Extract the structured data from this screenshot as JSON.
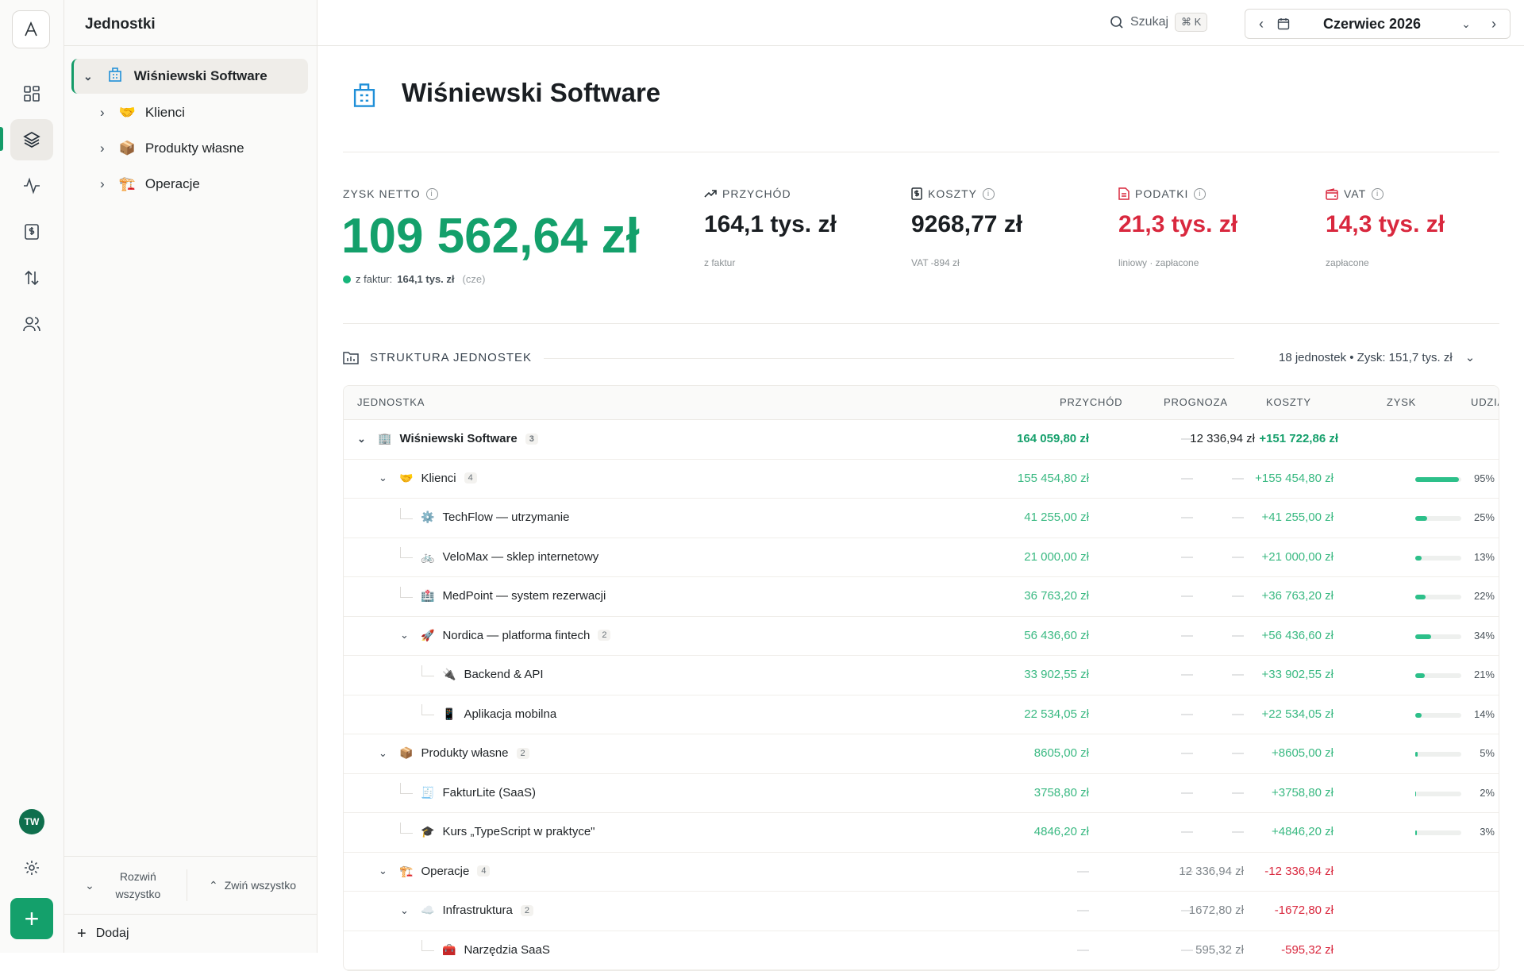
{
  "topbar": {
    "title": "Jednostki",
    "search_label": "Szukaj",
    "search_shortcut": "⌘ K",
    "month": "Czerwiec 2026"
  },
  "sidebar_user": "TW",
  "tree": {
    "root": "Wiśniewski Software",
    "items": [
      "Klienci",
      "Produkty własne",
      "Operacje"
    ],
    "expand_all": "Rozwiń wszystko",
    "collapse_all": "Zwiń wszystko",
    "add": "Dodaj"
  },
  "page": {
    "title": "Wiśniewski Software"
  },
  "kpis": {
    "net": {
      "label": "ZYSK NETTO",
      "value": "109 562,64 zł",
      "sub_prefix": "z faktur:",
      "sub_value": "164,1 tys. zł",
      "sub_suffix": "(cze)"
    },
    "revenue": {
      "label": "PRZYCHÓD",
      "value": "164,1 tys. zł",
      "sub": "z faktur"
    },
    "costs": {
      "label": "KOSZTY",
      "value": "9268,77 zł",
      "sub": "VAT -894 zł"
    },
    "taxes": {
      "label": "PODATKI",
      "value": "21,3 tys. zł",
      "sub": "liniowy · zapłacone"
    },
    "vat": {
      "label": "VAT",
      "value": "14,3 tys. zł",
      "sub": "zapłacone"
    }
  },
  "structure": {
    "label": "STRUKTURA JEDNOSTEK",
    "summary": "18 jednostek • Zysk: 151,7 tys. zł"
  },
  "table": {
    "headers": {
      "unit": "JEDNOSTKA",
      "revenue": "PRZYCHÓD",
      "forecast": "PROGNOZA",
      "costs": "KOSZTY",
      "profit": "ZYSK",
      "share": "UDZIAŁ"
    },
    "rows": [
      {
        "name": "Wiśniewski Software",
        "count": "3",
        "revenue": "164 059,80 zł",
        "forecast": "—",
        "costs": "12 336,94 zł",
        "profit": "+151 722,86 zł",
        "share": null,
        "share_label": "",
        "icon": "building-icon",
        "level": 0
      },
      {
        "name": "Klienci",
        "count": "4",
        "revenue": "155 454,80 zł",
        "forecast": "—",
        "costs": "—",
        "profit": "+155 454,80 zł",
        "share": 0.95,
        "share_label": "95%",
        "icon": "handshake-icon",
        "level": 1
      },
      {
        "name": "TechFlow — utrzymanie",
        "count": "",
        "revenue": "41 255,00 zł",
        "forecast": "—",
        "costs": "—",
        "profit": "+41 255,00 zł",
        "share": 0.25,
        "share_label": "25%",
        "icon": "gear-icon",
        "level": 2
      },
      {
        "name": "VeloMax — sklep internetowy",
        "count": "",
        "revenue": "21 000,00 zł",
        "forecast": "—",
        "costs": "—",
        "profit": "+21 000,00 zł",
        "share": 0.13,
        "share_label": "13%",
        "icon": "bicycle-icon",
        "level": 2
      },
      {
        "name": "MedPoint — system rezerwacji",
        "count": "",
        "revenue": "36 763,20 zł",
        "forecast": "—",
        "costs": "—",
        "profit": "+36 763,20 zł",
        "share": 0.22,
        "share_label": "22%",
        "icon": "hospital-icon",
        "level": 2
      },
      {
        "name": "Nordica — platforma fintech",
        "count": "2",
        "revenue": "56 436,60 zł",
        "forecast": "—",
        "costs": "—",
        "profit": "+56 436,60 zł",
        "share": 0.34,
        "share_label": "34%",
        "icon": "rocket-icon",
        "level": 2
      },
      {
        "name": "Backend & API",
        "count": "",
        "revenue": "33 902,55 zł",
        "forecast": "—",
        "costs": "—",
        "profit": "+33 902,55 zł",
        "share": 0.21,
        "share_label": "21%",
        "icon": "plug-icon",
        "level": 3
      },
      {
        "name": "Aplikacja mobilna",
        "count": "",
        "revenue": "22 534,05 zł",
        "forecast": "—",
        "costs": "—",
        "profit": "+22 534,05 zł",
        "share": 0.14,
        "share_label": "14%",
        "icon": "phone-icon",
        "level": 3
      },
      {
        "name": "Produkty własne",
        "count": "2",
        "revenue": "8605,00 zł",
        "forecast": "—",
        "costs": "—",
        "profit": "+8605,00 zł",
        "share": 0.05,
        "share_label": "5%",
        "icon": "package-icon",
        "level": 1
      },
      {
        "name": "FakturLite (SaaS)",
        "count": "",
        "revenue": "3758,80 zł",
        "forecast": "—",
        "costs": "—",
        "profit": "+3758,80 zł",
        "share": 0.02,
        "share_label": "2%",
        "icon": "receipt-icon",
        "level": 2
      },
      {
        "name": "Kurs „TypeScript w praktyce\"",
        "count": "",
        "revenue": "4846,20 zł",
        "forecast": "—",
        "costs": "—",
        "profit": "+4846,20 zł",
        "share": 0.03,
        "share_label": "3%",
        "icon": "graduation-cap-icon",
        "level": 2
      },
      {
        "name": "Operacje",
        "count": "4",
        "revenue": "—",
        "forecast": "—",
        "costs": "12 336,94 zł",
        "profit": "-12 336,94 zł",
        "share": null,
        "share_label": "",
        "icon": "crane-icon",
        "level": 1
      },
      {
        "name": "Infrastruktura",
        "count": "2",
        "revenue": "—",
        "forecast": "—",
        "costs": "1672,80 zł",
        "profit": "-1672,80 zł",
        "share": null,
        "share_label": "",
        "icon": "cloud-icon",
        "level": 2
      },
      {
        "name": "Narzędzia SaaS",
        "count": "",
        "revenue": "—",
        "forecast": "—",
        "costs": "595,32 zł",
        "profit": "-595,32 zł",
        "share": null,
        "share_label": "",
        "icon": "toolbox-icon",
        "level": 3
      }
    ]
  },
  "colors": {
    "accent": "#149b68",
    "profit": "#16a06c",
    "negative": "#d9283e",
    "tax": "#d9283e"
  }
}
